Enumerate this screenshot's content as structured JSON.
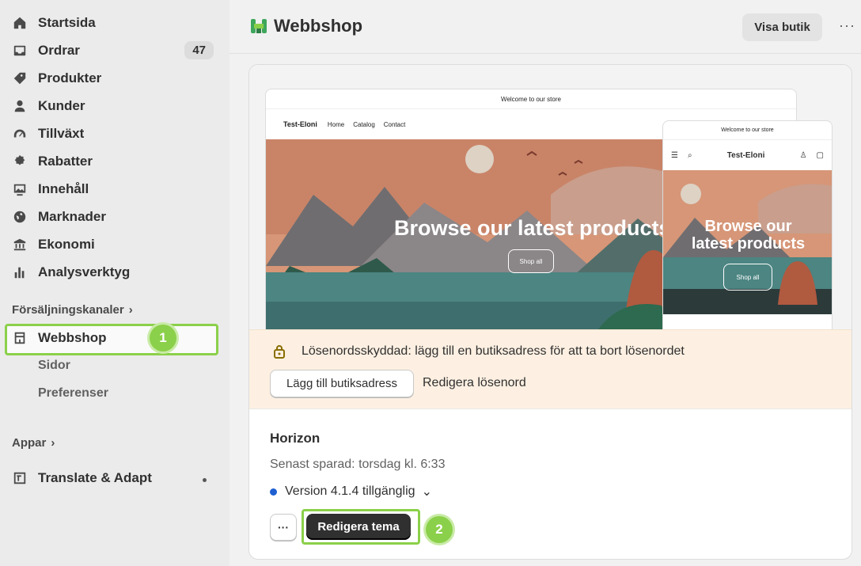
{
  "sidebar": {
    "items": [
      {
        "label": "Startsida",
        "icon": "home-icon"
      },
      {
        "label": "Ordrar",
        "icon": "inbox-icon",
        "badge": "47"
      },
      {
        "label": "Produkter",
        "icon": "tag-icon"
      },
      {
        "label": "Kunder",
        "icon": "person-icon"
      },
      {
        "label": "Tillväxt",
        "icon": "gauge-icon"
      },
      {
        "label": "Rabatter",
        "icon": "discount-icon"
      },
      {
        "label": "Innehåll",
        "icon": "image-icon"
      },
      {
        "label": "Marknader",
        "icon": "globe-icon"
      },
      {
        "label": "Ekonomi",
        "icon": "bank-icon"
      },
      {
        "label": "Analysverktyg",
        "icon": "bar-chart-icon"
      }
    ],
    "sales_channels_label": "Försäljningskanaler",
    "webbshop_label": "Webbshop",
    "webbshop_step": "1",
    "sub_items": [
      "Sidor",
      "Preferenser"
    ],
    "apps_label": "Appar",
    "app_item": "Translate & Adapt"
  },
  "header": {
    "title": "Webbshop",
    "view_store": "Visa butik",
    "more": "···"
  },
  "preview": {
    "announcement": "Welcome to our store",
    "brand": "Test-Eloni",
    "nav": [
      "Home",
      "Catalog",
      "Contact"
    ],
    "hero_text": "Browse our latest products",
    "hero_line1": "Browse our",
    "hero_line2": "latest products",
    "button": "Shop all"
  },
  "password_banner": {
    "text": "Lösenordsskyddad: lägg till en butiksadress för att ta bort lösenordet",
    "add_button": "Lägg till butiksadress",
    "edit_link": "Redigera lösenord"
  },
  "theme": {
    "name": "Horizon",
    "saved": "Senast sparad: torsdag kl. 6:33",
    "version": "Version 4.1.4 tillgänglig",
    "more_label": "···",
    "edit_button": "Redigera tema",
    "edit_step": "2"
  },
  "colors": {
    "highlight": "#8bd04a",
    "primary_button": "#303030",
    "banner_bg": "#fdf0e2",
    "version_dot": "#1f5fd1"
  }
}
